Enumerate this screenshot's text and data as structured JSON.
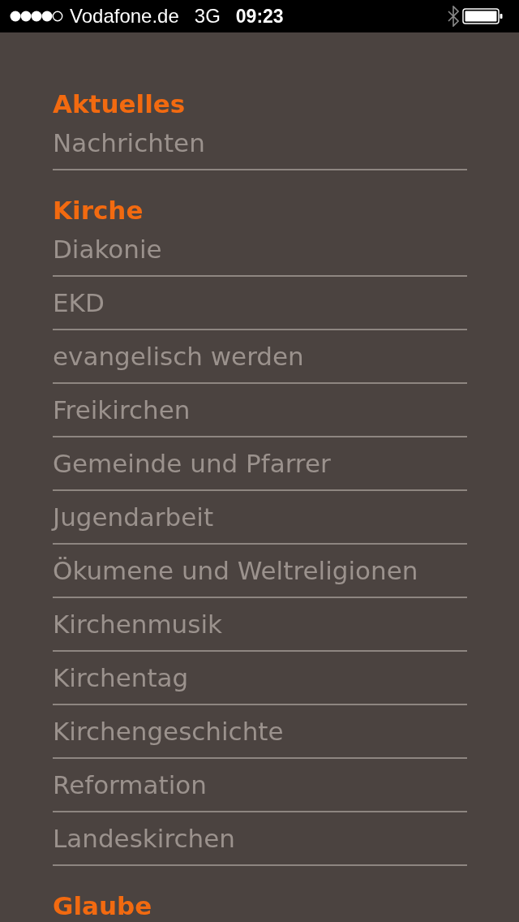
{
  "status_bar": {
    "carrier": "Vodafone.de",
    "network": "3G",
    "time": "09:23"
  },
  "sections": [
    {
      "title": "Aktuelles",
      "items": [
        {
          "label": "Nachrichten"
        }
      ]
    },
    {
      "title": "Kirche",
      "items": [
        {
          "label": "Diakonie"
        },
        {
          "label": "EKD"
        },
        {
          "label": "evangelisch werden"
        },
        {
          "label": "Freikirchen"
        },
        {
          "label": "Gemeinde und Pfarrer"
        },
        {
          "label": "Jugendarbeit"
        },
        {
          "label": "Ökumene und Weltreligionen"
        },
        {
          "label": "Kirchenmusik"
        },
        {
          "label": "Kirchentag"
        },
        {
          "label": "Kirchengeschichte"
        },
        {
          "label": "Reformation"
        },
        {
          "label": "Landeskirchen"
        }
      ]
    },
    {
      "title": "Glaube"
    }
  ]
}
